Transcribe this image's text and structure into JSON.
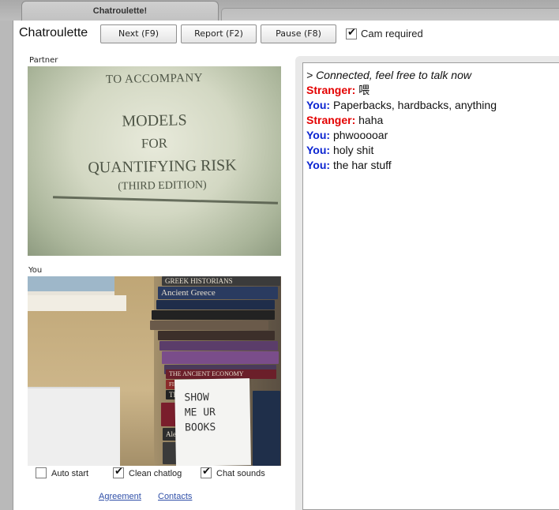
{
  "tab": {
    "title": "Chatroulette!"
  },
  "toolbar": {
    "app_title": "Chatroulette",
    "next_label": "Next (F9)",
    "report_label": "Report (F2)",
    "pause_label": "Pause (F8)",
    "cam_required_label": "Cam required",
    "cam_required_checked": true
  },
  "partner": {
    "caption": "Partner",
    "cover_lines": [
      "TO ACCOMPANY",
      "MODELS",
      "FOR",
      "QUANTIFYING RISK",
      "(THIRD EDITION)"
    ]
  },
  "you": {
    "caption": "You",
    "sign_lines": [
      "SHOW",
      "ME UR",
      "BOOKS"
    ],
    "book_spines": [
      "GREEK HISTORIANS",
      "Ancient Greece",
      "THE ANCIENT ECONOMY",
      "FINLEY",
      "THE TER",
      "Alexis de"
    ]
  },
  "options": {
    "auto_start_label": "Auto start",
    "auto_start_checked": false,
    "clean_chatlog_label": "Clean chatlog",
    "clean_chatlog_checked": true,
    "chat_sounds_label": "Chat sounds",
    "chat_sounds_checked": true
  },
  "links": {
    "agreement": "Agreement",
    "contacts": "Contacts"
  },
  "chat": {
    "system_message": "> Connected, feel free to talk now",
    "messages": [
      {
        "speaker": "Stranger:",
        "text": "喂"
      },
      {
        "speaker": "You:",
        "text": "Paperbacks, hardbacks, anything"
      },
      {
        "speaker": "Stranger:",
        "text": "haha"
      },
      {
        "speaker": "You:",
        "text": "phwooooar"
      },
      {
        "speaker": "You:",
        "text": "holy shit"
      },
      {
        "speaker": "You:",
        "text": "the har stuff"
      }
    ]
  },
  "colors": {
    "stranger": "#e40000",
    "you": "#0b24d1",
    "link": "#2f4fa8"
  }
}
